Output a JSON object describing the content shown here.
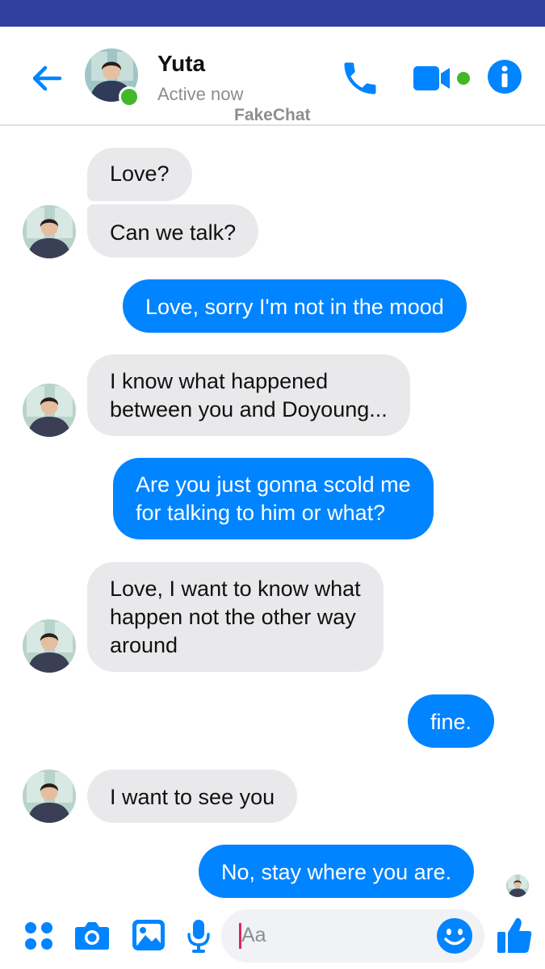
{
  "header": {
    "contact_name": "Yuta",
    "status": "Active now",
    "watermark": "FakeChat",
    "back_icon": "arrow-left-icon",
    "call_icon": "phone-icon",
    "video_icon": "video-camera-icon",
    "info_icon": "info-icon"
  },
  "messages": [
    {
      "from": "contact",
      "lines": [
        "Love?"
      ]
    },
    {
      "from": "contact",
      "lines": [
        "Can we talk?"
      ]
    },
    {
      "from": "me",
      "lines": [
        "Love, sorry I'm not in the mood"
      ]
    },
    {
      "from": "contact",
      "lines": [
        "I know what happened",
        "between you and Doyoung..."
      ]
    },
    {
      "from": "me",
      "lines": [
        "Are you just gonna scold me",
        "for talking to him or what?"
      ]
    },
    {
      "from": "contact",
      "lines": [
        "Love, I want to know what",
        "happen not the other way",
        "around"
      ]
    },
    {
      "from": "me",
      "lines": [
        "fine."
      ]
    },
    {
      "from": "contact",
      "lines": [
        "I want to see you"
      ]
    },
    {
      "from": "me",
      "lines": [
        "No, stay where you are."
      ]
    }
  ],
  "composer": {
    "placeholder": "Aa",
    "icons": [
      "menu-dots-icon",
      "camera-icon",
      "image-icon",
      "microphone-icon",
      "emoji-icon",
      "thumbs-up-icon"
    ]
  },
  "colors": {
    "status_bar": "#303f9f",
    "accent": "#0084ff",
    "incoming_bubble": "#e9e9eb",
    "presence": "#42b72a"
  }
}
